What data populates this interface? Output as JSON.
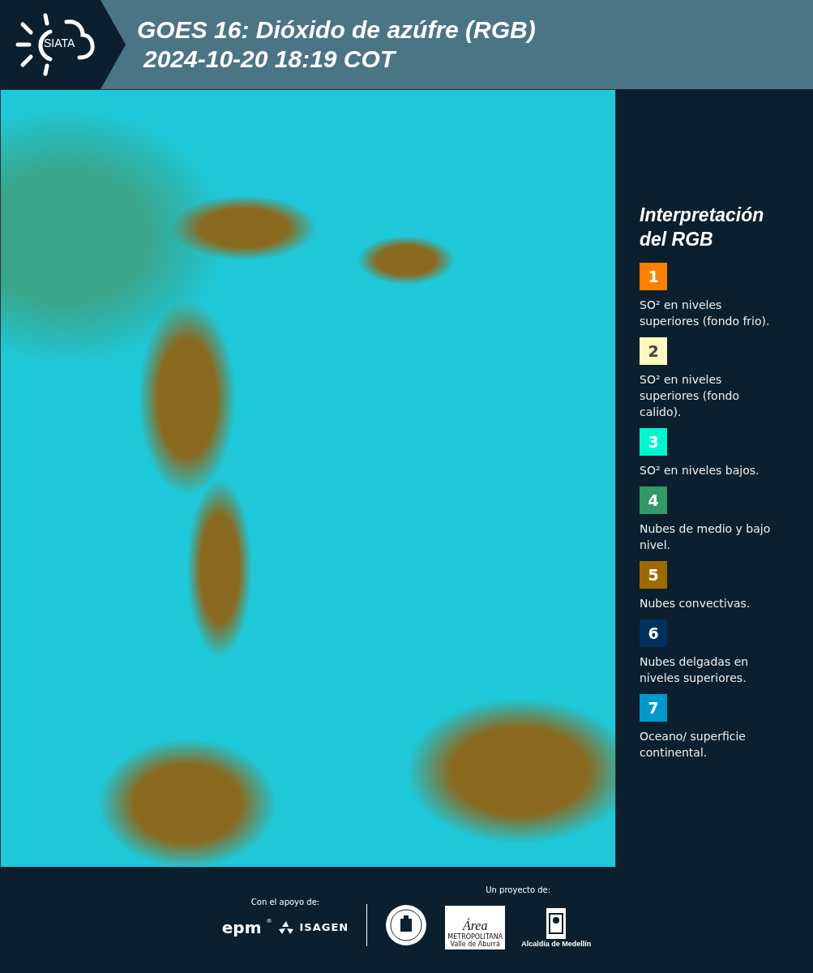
{
  "header": {
    "logo_text": "SIATA",
    "title": "GOES 16: Dióxido de azúfre (RGB)",
    "timestamp": "2024-10-20 18:19 COT"
  },
  "legend": {
    "title": "Interpretación del RGB",
    "items": [
      {
        "number": "1",
        "color": "#ff7f00",
        "text": "SO² en niveles superiores (fondo frio)."
      },
      {
        "number": "2",
        "color": "#fff9c0",
        "text": "SO² en niveles superiores (fondo calido)."
      },
      {
        "number": "3",
        "color": "#00f5d0",
        "text": "SO² en niveles bajos."
      },
      {
        "number": "4",
        "color": "#339966",
        "text": "Nubes de medio y bajo nivel."
      },
      {
        "number": "5",
        "color": "#9e6a00",
        "text": "Nubes convectivas."
      },
      {
        "number": "6",
        "color": "#00305e",
        "text": "Nubes delgadas en niveles superiores."
      },
      {
        "number": "7",
        "color": "#0099cc",
        "text": "Oceano/ superficie continental."
      }
    ]
  },
  "footer": {
    "support_label": "Con el apoyo de:",
    "project_label": "Un proyecto de:",
    "epm": "epm",
    "registered": "®",
    "isagen": "ISAGEN",
    "area": "Área",
    "area_sub": "METROPOLITANA",
    "area_sub2": "Valle de Aburrá",
    "alcaldia": "Alcaldía de Medellín"
  }
}
